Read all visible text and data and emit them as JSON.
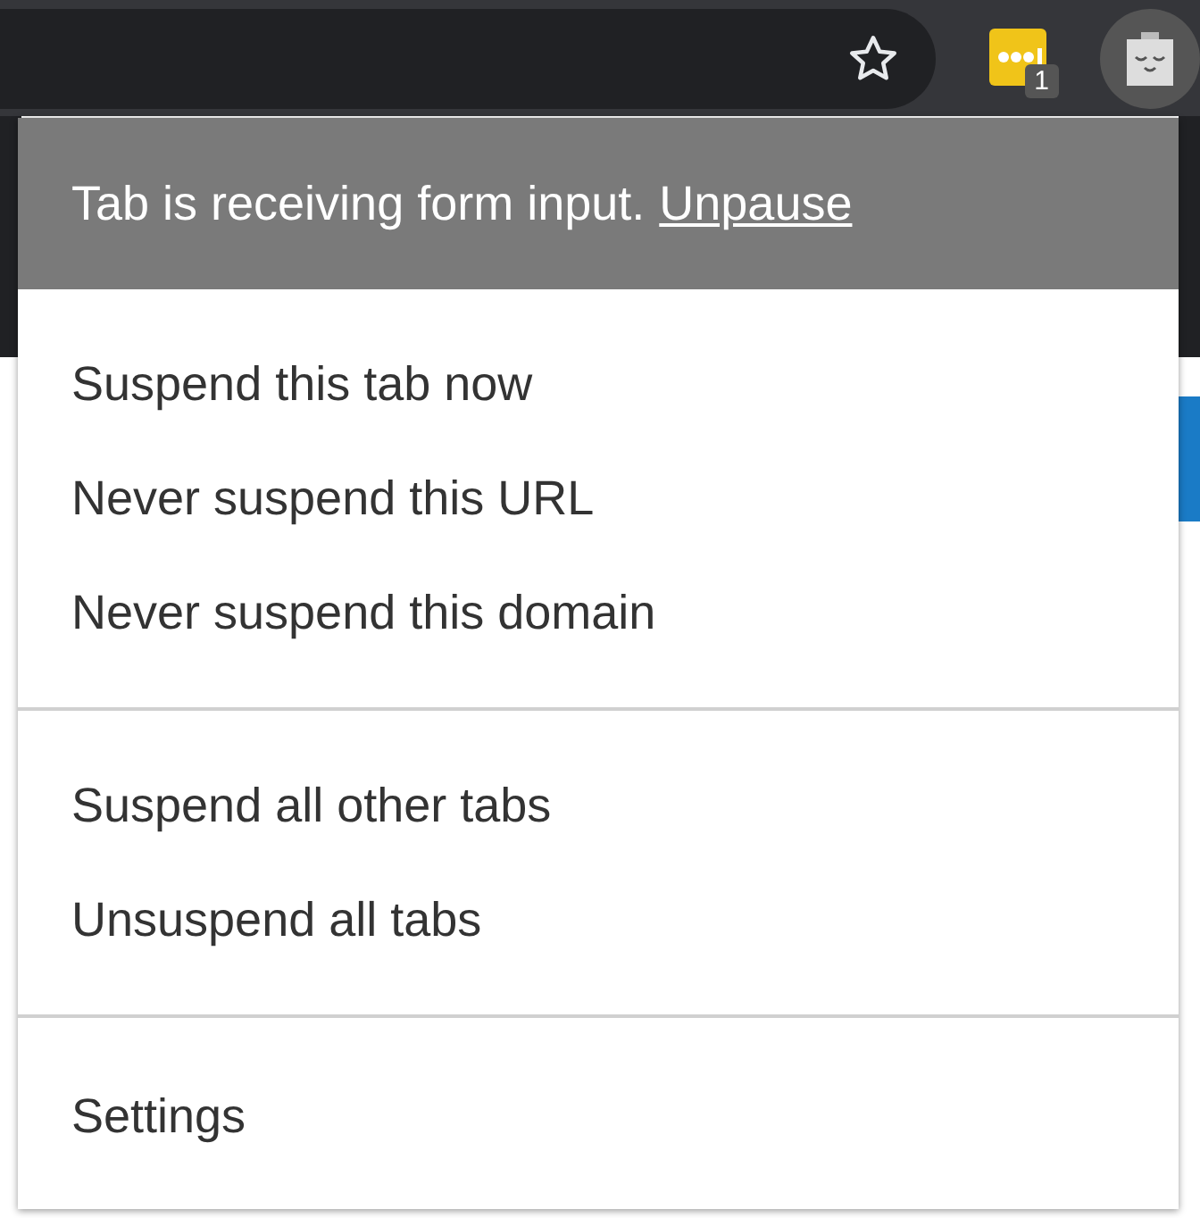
{
  "toolbar": {
    "extension_badge": "1"
  },
  "menu": {
    "notice": {
      "text": "Tab is receiving form input.",
      "link": "Unpause"
    },
    "groups": [
      [
        "Suspend this tab now",
        "Never suspend this URL",
        "Never suspend this domain"
      ],
      [
        "Suspend all other tabs",
        "Unsuspend all tabs"
      ],
      [
        "Settings"
      ]
    ]
  }
}
